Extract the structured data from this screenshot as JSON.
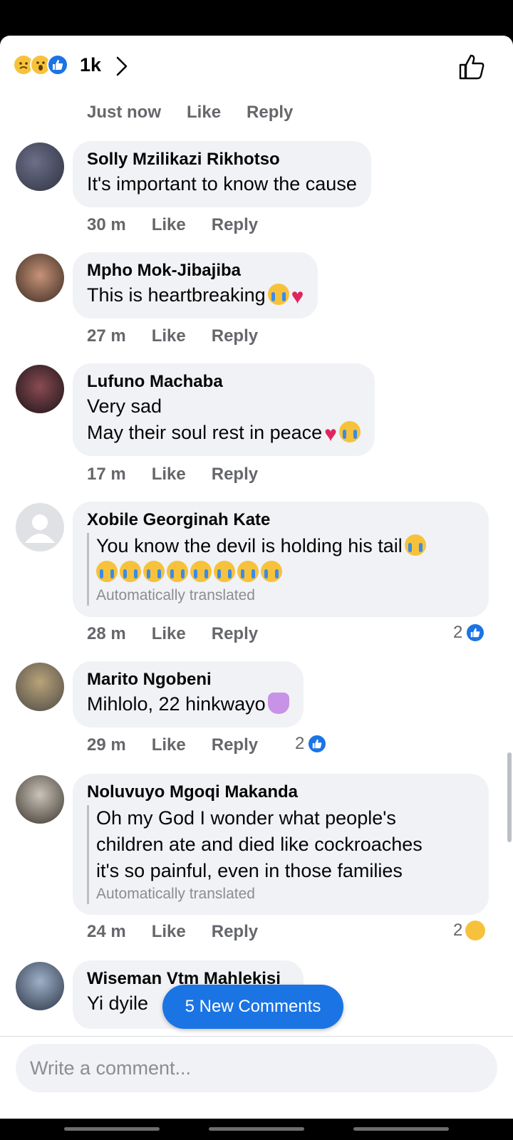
{
  "header": {
    "reaction_count": "1k",
    "reactions": [
      "sad-icon",
      "wow-icon",
      "like-icon"
    ]
  },
  "top_meta": {
    "time": "Just now",
    "like": "Like",
    "reply": "Reply"
  },
  "comments": [
    {
      "name": "Solly Mzilikazi Rikhotso",
      "lines": [
        "It's important to know the cause"
      ],
      "time": "30 m",
      "like": "Like",
      "reply": "Reply"
    },
    {
      "name": "Mpho Mok-Jibajiba",
      "lines": [
        "This is heartbreaking"
      ],
      "time": "27 m",
      "like": "Like",
      "reply": "Reply"
    },
    {
      "name": "Lufuno Machaba",
      "lines": [
        "Very sad",
        "May their soul rest in peace"
      ],
      "time": "17 m",
      "like": "Like",
      "reply": "Reply"
    },
    {
      "name": "Xobile Georginah Kate",
      "lines": [
        "You know the devil is holding his tail"
      ],
      "translated": "Automatically translated",
      "time": "28 m",
      "like": "Like",
      "reply": "Reply",
      "reactions": "2"
    },
    {
      "name": "Marito Ngobeni",
      "lines": [
        "Mihlolo, 22 hinkwayo"
      ],
      "time": "29 m",
      "like": "Like",
      "reply": "Reply",
      "reactions": "2"
    },
    {
      "name": "Noluvuyo Mgoqi Makanda",
      "lines": [
        "Oh my God I wonder what people's",
        "children ate and died like cockroaches",
        "it's so painful, even in those families"
      ],
      "translated": "Automatically translated",
      "time": "24 m",
      "like": "Like",
      "reply": "Reply",
      "reactions": "2"
    },
    {
      "name": "Wiseman Vtm Mahlekisi",
      "lines": [
        "Yi dyile"
      ]
    }
  ],
  "new_comments_label": "5 New Comments",
  "composer": {
    "placeholder": "Write a comment..."
  },
  "colors": {
    "accent": "#1b74e4",
    "bubble": "#f0f2f5",
    "meta": "#65676b"
  }
}
